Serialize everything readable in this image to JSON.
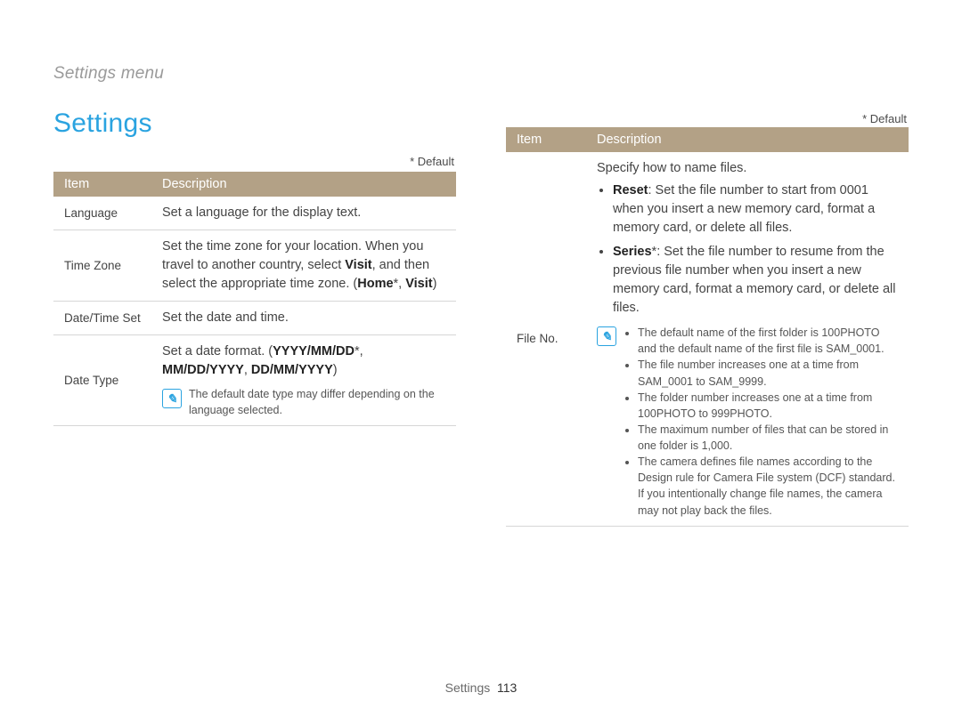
{
  "breadcrumb": "Settings menu",
  "title": "Settings",
  "default_note": "* Default",
  "table_header": {
    "item": "Item",
    "description": "Description"
  },
  "left_rows": {
    "language": {
      "item": "Language",
      "desc": "Set a language for the display text."
    },
    "timezone": {
      "item": "Time Zone",
      "desc_pre": "Set the time zone for your location. When you travel to another country, select ",
      "visit": "Visit",
      "desc_mid": ", and then select the appropriate time zone. (",
      "home": "Home",
      "sep": "*, ",
      "visit2": "Visit",
      "desc_end": ")"
    },
    "datetime": {
      "item": "Date/Time Set",
      "desc": "Set the date and time."
    },
    "datetype": {
      "item": "Date Type",
      "lead": "Set a date format. (",
      "opt1": "YYYY/MM/DD",
      "star": "*, ",
      "opt2": "MM/DD/YYYY",
      "comma": ", ",
      "opt3": "DD/MM/YYYY",
      "close": ")",
      "note": "The default date type may differ depending on the language selected."
    }
  },
  "right_rows": {
    "fileno": {
      "item": "File No.",
      "lead": "Specify how to name files.",
      "bullets_main": {
        "reset_label": "Reset",
        "reset_text": ": Set the file number to start from 0001 when you insert a new memory card, format a memory card, or delete all files.",
        "series_label": "Series",
        "series_star": "*",
        "series_text": ": Set the file number to resume from the previous file number when you insert a new memory card, format a memory card, or delete all files."
      },
      "notes": [
        "The default name of the first folder is 100PHOTO and the default name of the first file is SAM_0001.",
        "The file number increases one at a time from SAM_0001 to SAM_9999.",
        "The folder number increases one at a time from 100PHOTO to 999PHOTO.",
        "The maximum number of files that can be stored in one folder is 1,000.",
        "The camera defines file names according to the Design rule for Camera File system (DCF) standard. If you intentionally change file names, the camera may not play back the files."
      ]
    }
  },
  "note_icon_glyph": "✎",
  "footer": {
    "section": "Settings",
    "page": "113"
  }
}
